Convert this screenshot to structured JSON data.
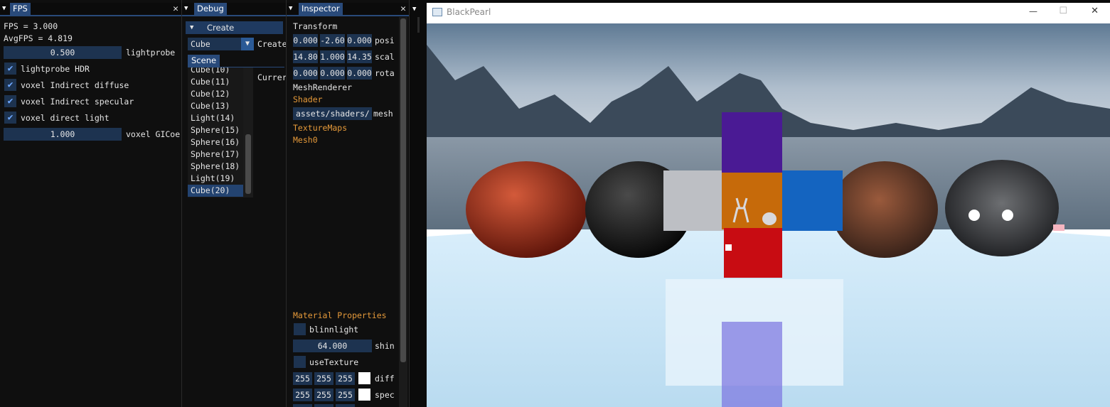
{
  "fps_panel": {
    "title": "FPS",
    "fps_text": "FPS = 3.000",
    "avgfps_text": "AvgFPS = 4.819",
    "lightprobe_value": "0.500",
    "lightprobe_label": "lightprobe",
    "checkboxes": [
      "lightprobe HDR",
      "voxel Indirect diffuse",
      "voxel Indirect specular",
      "voxel direct light"
    ],
    "gicoeff_value": "1.000",
    "gicoeff_label": "voxel GICoe"
  },
  "debug_panel": {
    "title": "Debug",
    "create_header": "Create",
    "combo_value": "Cube",
    "create_button": "Create",
    "scene_tab": "Scene",
    "current_label": "Currer",
    "scene_items": [
      "Cube(10)",
      "Cube(11)",
      "Cube(12)",
      "Cube(13)",
      "Light(14)",
      "Sphere(15)",
      "Sphere(16)",
      "Sphere(17)",
      "Sphere(18)",
      "Light(19)",
      "Cube(20)"
    ],
    "selected_item": "Cube(20)"
  },
  "inspector_panel": {
    "title": "Inspector",
    "transform_label": "Transform",
    "position": [
      "0.000",
      "-2.60",
      "0.000"
    ],
    "position_label": "posi",
    "scale": [
      "14.80",
      "1.000",
      "14.35"
    ],
    "scale_label": "scal",
    "rotation": [
      "0.000",
      "0.000",
      "0.000"
    ],
    "rotation_label": "rota",
    "meshrenderer_label": "MeshRenderer",
    "shader_label": "Shader",
    "shader_path": "assets/shaders/",
    "shader_suffix": "mesh",
    "texturemaps_label": "TextureMaps",
    "mesh0_label": "Mesh0",
    "material_properties_label": "Material Properties",
    "blinnlight_label": "blinnlight",
    "shininess_value": "64.000",
    "shininess_label": "shin",
    "usetexture_label": "useTexture",
    "diffuse": [
      "255",
      "255",
      "255"
    ],
    "diffuse_label": "diff",
    "specular": [
      "255",
      "255",
      "255"
    ],
    "specular_label": "spec"
  },
  "viewport": {
    "window_title": "BlackPearl",
    "minimize": "—",
    "maximize": "☐",
    "close": "✕"
  },
  "colors": {
    "accent": "#294a7a",
    "field_bg": "#1d3350",
    "orange_text": "#e69a3a"
  }
}
